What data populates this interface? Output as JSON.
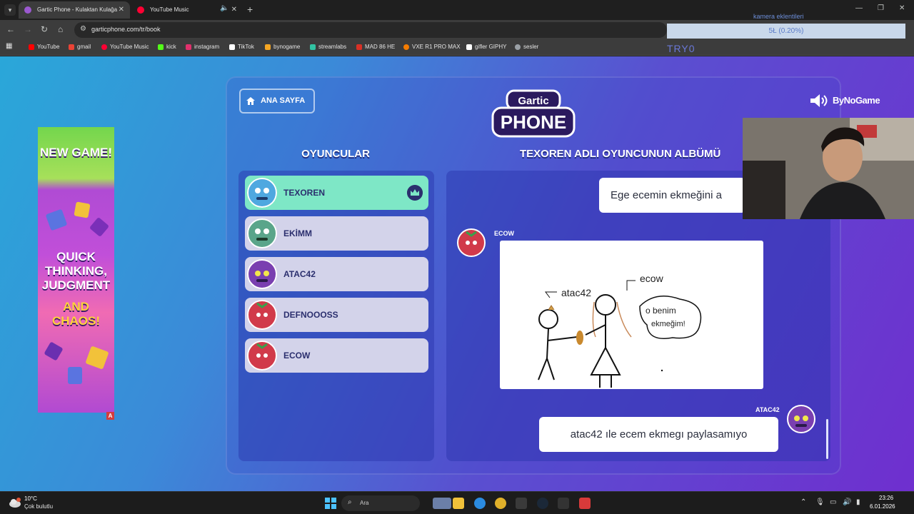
{
  "browser": {
    "tabs": [
      {
        "title": "Gartic Phone - Kulaktan Kulağa",
        "active": true,
        "favicon_color": "#9b59d0"
      },
      {
        "title": "YouTube Music",
        "active": false,
        "favicon_color": "#ff0033"
      }
    ],
    "url": "garticphone.com/tr/book",
    "bookmarks": [
      {
        "label": "YouTube",
        "color": "#ff0000"
      },
      {
        "label": "gmail",
        "color": "#ea4335"
      },
      {
        "label": "YouTube Music",
        "color": "#ff0033"
      },
      {
        "label": "kick",
        "color": "#53fc18"
      },
      {
        "label": "instagram",
        "color": "#e1306c"
      },
      {
        "label": "TikTok",
        "color": "#ffffff"
      },
      {
        "label": "bynogame",
        "color": "#f5a623"
      },
      {
        "label": "streamlabs",
        "color": "#31c3a2"
      },
      {
        "label": "MAD 86 HE",
        "color": "#d93025"
      },
      {
        "label": "VXE R1 PRO MAX",
        "color": "#f57c00"
      },
      {
        "label": "gifler GIPHY",
        "color": "#ffffff"
      },
      {
        "label": "sesler",
        "color": "#9aa0a6"
      }
    ]
  },
  "overlay": {
    "title": "kamera eklentileri",
    "progress_text": "5Ł (0.20%)",
    "try_text": "TRY0"
  },
  "game": {
    "home_label": "ANA SAYFA",
    "players_heading": "OYUNCULAR",
    "album_heading": "TEXOREN ADLI OYUNCUNUN ALBÜMÜ",
    "brand": "ByNoGame",
    "players": [
      {
        "name": "TEXOREN",
        "host": true,
        "avatar_color": "#4fa8e0"
      },
      {
        "name": "EKİMM",
        "host": false,
        "avatar_color": "#5aa58a"
      },
      {
        "name": "ATAC42",
        "host": false,
        "avatar_color": "#7a3fb0"
      },
      {
        "name": "DEFNOOOSS",
        "host": false,
        "avatar_color": "#d13a4a"
      },
      {
        "name": "ECOW",
        "host": false,
        "avatar_color": "#d13a4a"
      }
    ],
    "album": {
      "first_text": "Ege ecemin ekmeğini a",
      "drawing_author": "ECOW",
      "drawing_texts": [
        "atac42",
        "ecow",
        "o benim",
        "ekmeğim!"
      ],
      "reply_author": "ATAC42",
      "reply_text": "atac42 ıle ecem ekmegı paylasamıyo"
    }
  },
  "ad": {
    "line1": "NEW GAME!",
    "line2": "QUICK THINKING, JUDGMENT",
    "line3": "AND CHAOS!",
    "badge": "A"
  },
  "taskbar": {
    "temperature": "10°C",
    "weather": "Çok bulutlu",
    "search_placeholder": "Ara",
    "time": "23:26",
    "date": "6.01.2026"
  }
}
